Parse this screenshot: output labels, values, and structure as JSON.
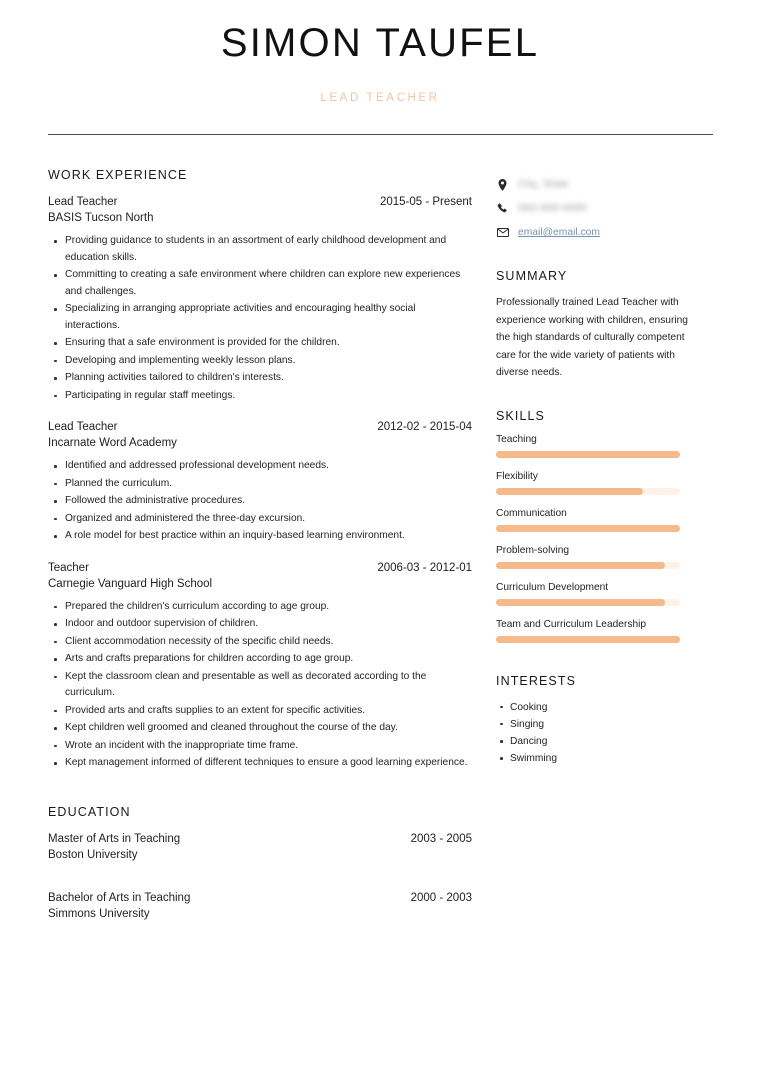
{
  "header": {
    "full_name": "SIMON TAUFEL",
    "job_title": "LEAD TEACHER",
    "title_color": "#f3c3a4"
  },
  "contact": {
    "location": "City, State",
    "phone": "000-000-0000",
    "email": "email@email.com",
    "location_icon": "map-pin-icon",
    "phone_icon": "phone-icon",
    "email_icon": "envelope-icon",
    "email_color": "#7a93ad"
  },
  "sections": {
    "work_experience_title": "WORK EXPERIENCE",
    "education_title": "EDUCATION",
    "summary_title": "SUMMARY",
    "skills_title": "SKILLS",
    "interests_title": "INTERESTS"
  },
  "summary": {
    "text": "Professionally trained Lead Teacher with experience working with children, ensuring the high standards of culturally competent care for the wide variety of patients with diverse needs."
  },
  "work_experience": [
    {
      "role": "Lead Teacher",
      "date": "2015-05 - Present",
      "organization": "BASIS Tucson North",
      "bullets": [
        "Providing guidance to students in an assortment of early childhood development and education skills.",
        "Committing to creating a safe environment where children can explore new experiences and challenges.",
        "Specializing in arranging appropriate activities and encouraging healthy social interactions.",
        "Ensuring that a safe environment is provided for the children.",
        "Developing and implementing weekly lesson plans.",
        "Planning activities tailored to children's interests.",
        "Participating in regular staff meetings."
      ]
    },
    {
      "role": "Lead Teacher",
      "date": "2012-02 - 2015-04",
      "organization": "Incarnate Word Academy",
      "bullets": [
        "Identified and addressed professional development needs.",
        "Planned the curriculum.",
        "Followed the administrative procedures.",
        "Organized and administered the three-day excursion.",
        "A role model for best practice within an inquiry-based learning environment."
      ]
    },
    {
      "role": "Teacher",
      "date": "2006-03 - 2012-01",
      "organization": "Carnegie Vanguard High School",
      "bullets": [
        "Prepared the children's curriculum according to age group.",
        "Indoor and outdoor supervision of children.",
        "Client accommodation necessity of the specific child needs.",
        "Arts and crafts preparations for children according to age group.",
        "Kept the classroom clean and presentable as well as decorated according to the curriculum.",
        "Provided arts and crafts supplies to an extent for specific activities.",
        "Kept children well groomed and cleaned throughout the course of the day.",
        "Wrote an incident with the inappropriate time frame.",
        "Kept management informed of different techniques to ensure a good learning experience."
      ]
    }
  ],
  "education": [
    {
      "degree": "Master of Arts in Teaching",
      "date": "2003 - 2005",
      "school": "Boston University"
    },
    {
      "degree": "Bachelor of Arts in Teaching",
      "date": "2000 - 2003",
      "school": "Simmons University"
    }
  ],
  "skills": [
    {
      "name": "Teaching",
      "level": 100
    },
    {
      "name": "Flexibility",
      "level": 80
    },
    {
      "name": "Communication",
      "level": 100
    },
    {
      "name": "Problem-solving",
      "level": 92
    },
    {
      "name": "Curriculum Development",
      "level": 92
    },
    {
      "name": "Team and Curriculum Leadership",
      "level": 100
    }
  ],
  "skill_colors": {
    "fill": "#f5b98a",
    "track": "#fdf1ea"
  },
  "interests": [
    "Cooking",
    "Singing",
    "Dancing",
    "Swimming"
  ]
}
